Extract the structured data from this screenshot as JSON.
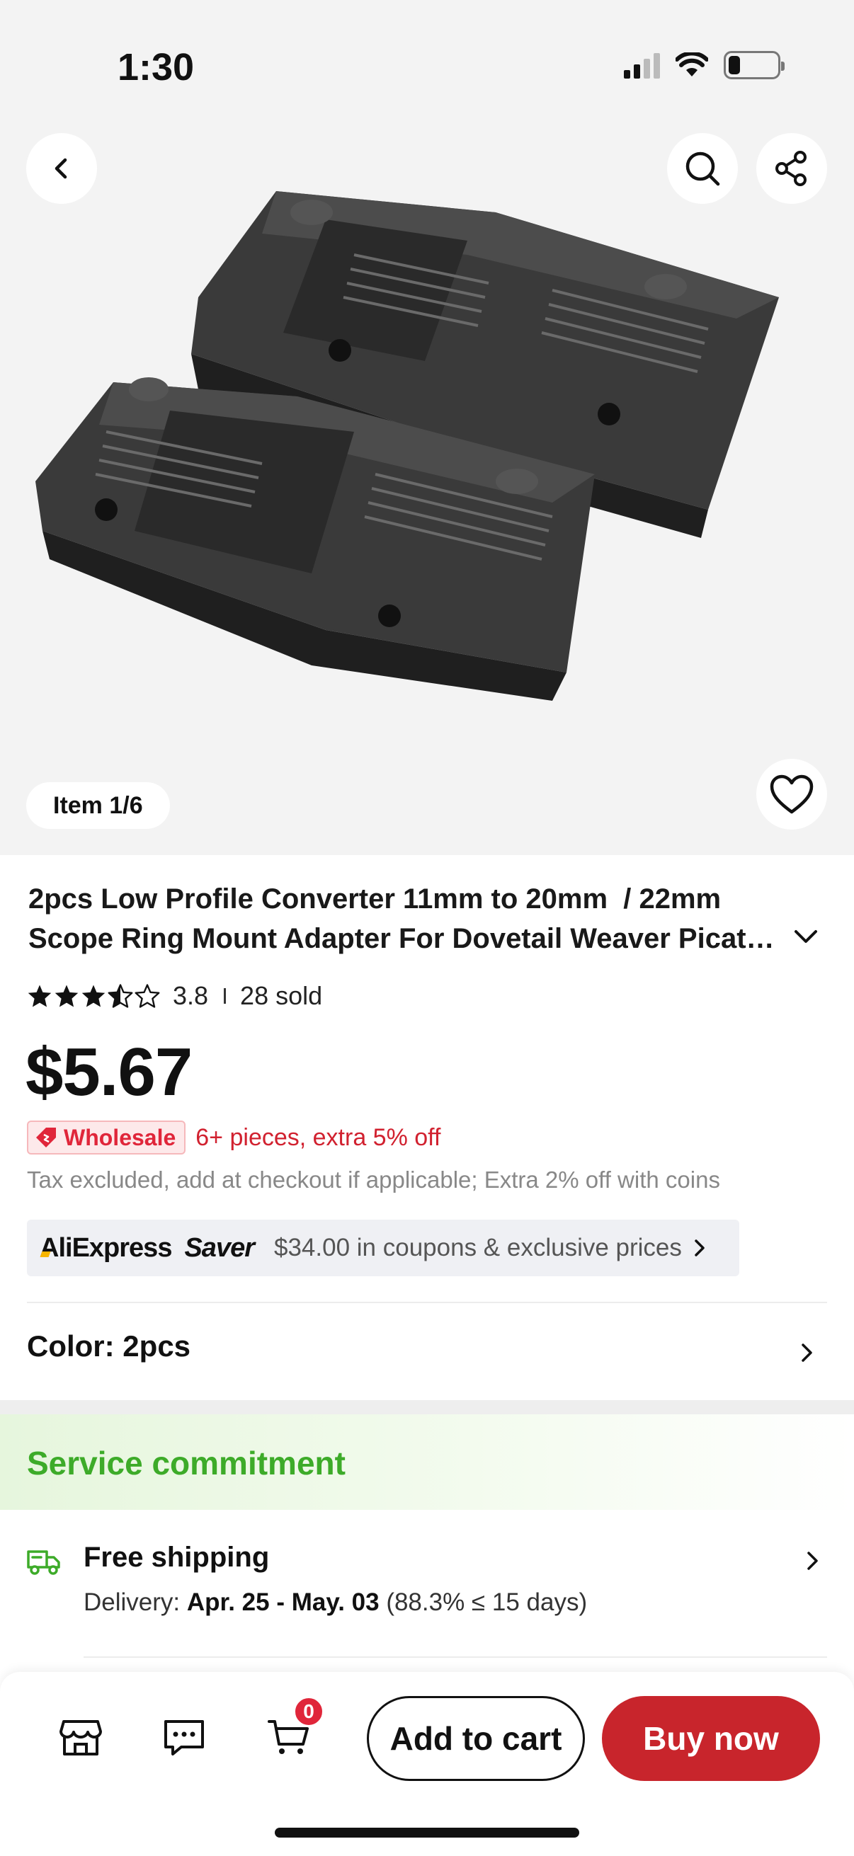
{
  "status_bar": {
    "time": "1:30"
  },
  "gallery": {
    "item_counter": "Item 1/6"
  },
  "product": {
    "title_line1": "2pcs Low Profile Converter 11mm to 20mm  / 22mm",
    "title_line2": "Scope Ring Mount Adapter For Dovetail Weaver Picatinny Rail",
    "rating": "3.8",
    "rating_fraction": 0.76,
    "sold": "28 sold",
    "price": "$5.67",
    "wholesale_label": "Wholesale",
    "wholesale_offer": "6+ pieces, extra 5% off",
    "tax_note": "Tax excluded, add at checkout if applicable; Extra 2% off with coins",
    "color": "Color: 2pcs"
  },
  "saver": {
    "brand_prefix": "A",
    "brand_rest": "liExpress",
    "brand_saver": "Saver",
    "text": "$34.00 in coupons & exclusive prices"
  },
  "service": {
    "heading": "Service commitment",
    "shipping_title": "Free shipping",
    "delivery_label": "Delivery:",
    "delivery_dates": "Apr. 25 - May. 03",
    "delivery_stat": "(88.3% ≤ 15 days)"
  },
  "bottom_bar": {
    "cart_count": "0",
    "add_to_cart": "Add to cart",
    "buy_now": "Buy now"
  },
  "colors": {
    "accent_red": "#c8252c",
    "service_green": "#3dab29",
    "wholesale_red": "#e0263a"
  }
}
